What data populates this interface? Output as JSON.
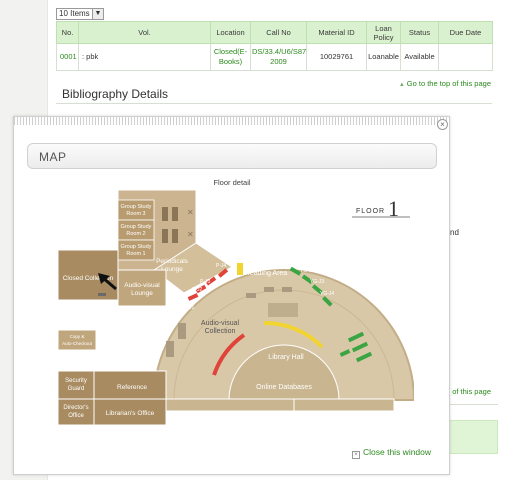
{
  "items_select": {
    "value": "10 Items",
    "arrow": "▼"
  },
  "table": {
    "headers": [
      "No.",
      "Vol.",
      "Location",
      "Call No",
      "Material ID",
      "Loan Policy",
      "Status",
      "Due Date"
    ],
    "rows": [
      {
        "no": "0001",
        "vol": ": pbk",
        "location": "Closed(E-Books)",
        "call_no": "DS/33.4/U6/S87 2009",
        "material_id": "10029761",
        "loan_policy": "Loanable",
        "status": "Available",
        "due_date": ""
      }
    ]
  },
  "go_top": "Go to the top of this page",
  "go_top_2": "of this page",
  "bibliography_title": "Bibliography Details",
  "right_fragment": "nd",
  "modal": {
    "title": "MAP",
    "close_glyph": "×",
    "close_window": "Close this window",
    "close_box_glyph": "×"
  },
  "map": {
    "floor_detail": "Floor detail",
    "floor_label": "FLOOR",
    "floor_number": "1",
    "rooms": {
      "group_study_3": [
        "Group Study",
        "Room 3"
      ],
      "group_study_2": [
        "Group Study",
        "Room 2"
      ],
      "group_study_1": [
        "Group Study",
        "Room 1"
      ],
      "periodicals": [
        "Periodicals",
        "Lounge"
      ],
      "closed_collection": "Closed Collection",
      "av_lounge": [
        "Audio-visual",
        "Lounge"
      ],
      "copy": [
        "Copy &",
        "Auto-Checkout"
      ],
      "security": [
        "Security",
        "Guard"
      ],
      "reference": "Reference",
      "directors": [
        "Director's",
        "Office"
      ],
      "librarians": "Librarian's Office",
      "reading_area": "Reading Area",
      "av_collection": [
        "Audio-visual",
        "Collection"
      ],
      "library_hall": "Library Hall",
      "online_db": "Online Databases"
    },
    "shelf_labels": {
      "p": [
        "P-J1",
        "P-J2",
        "P-J3",
        "P-J4"
      ],
      "y": [
        "Y-J1"
      ],
      "yg": [
        "YG-J1",
        "YG-J2",
        "YG-J3",
        "YG-J4"
      ]
    },
    "colors": {
      "red": "#e0433a",
      "yellow": "#f2d431",
      "green": "#3aa542",
      "floor": "#d9c8a8",
      "wall": "#a88f66"
    }
  }
}
